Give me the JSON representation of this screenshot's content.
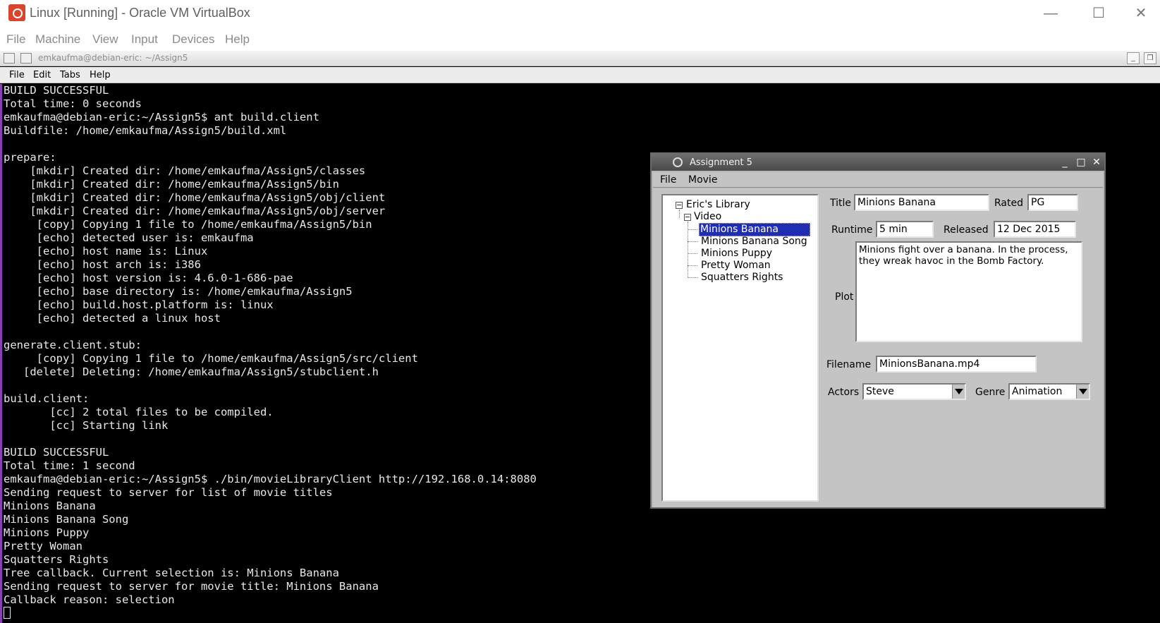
{
  "vbox": {
    "title": "Linux [Running] - Oracle VM VirtualBox",
    "controls": {
      "minimize": "—",
      "maximize": "☐",
      "close": "✕"
    },
    "menu": [
      "File",
      "Machine",
      "View",
      "Input",
      "Devices",
      "Help"
    ]
  },
  "terminal": {
    "title": "emkaufma@debian-eric: ~/Assign5",
    "menu": [
      "File",
      "Edit",
      "Tabs",
      "Help"
    ],
    "lines": [
      "BUILD SUCCESSFUL",
      "Total time: 0 seconds",
      "emkaufma@debian-eric:~/Assign5$ ant build.client",
      "Buildfile: /home/emkaufma/Assign5/build.xml",
      "",
      "prepare:",
      "    [mkdir] Created dir: /home/emkaufma/Assign5/classes",
      "    [mkdir] Created dir: /home/emkaufma/Assign5/bin",
      "    [mkdir] Created dir: /home/emkaufma/Assign5/obj/client",
      "    [mkdir] Created dir: /home/emkaufma/Assign5/obj/server",
      "     [copy] Copying 1 file to /home/emkaufma/Assign5/bin",
      "     [echo] detected user is: emkaufma",
      "     [echo] host name is: Linux",
      "     [echo] host arch is: i386",
      "     [echo] host version is: 4.6.0-1-686-pae",
      "     [echo] base directory is: /home/emkaufma/Assign5",
      "     [echo] build.host.platform is: linux",
      "     [echo] detected a linux host",
      "",
      "generate.client.stub:",
      "     [copy] Copying 1 file to /home/emkaufma/Assign5/src/client",
      "   [delete] Deleting: /home/emkaufma/Assign5/stubclient.h",
      "",
      "build.client:",
      "       [cc] 2 total files to be compiled.",
      "       [cc] Starting link",
      "",
      "BUILD SUCCESSFUL",
      "Total time: 1 second",
      "emkaufma@debian-eric:~/Assign5$ ./bin/movieLibraryClient http://192.168.0.14:8080",
      "Sending request to server for list of movie titles",
      "Minions Banana",
      "Minions Banana Song",
      "Minions Puppy",
      "Pretty Woman",
      "Squatters Rights",
      "Tree callback. Current selection is: Minions Banana",
      "Sending request to server for movie title: Minions Banana",
      "Callback reason: selection"
    ]
  },
  "dialog": {
    "title": "Assignment 5",
    "menu": [
      "File",
      "Movie"
    ],
    "tree": {
      "root": "Eric's Library",
      "category": "Video",
      "items": [
        "Minions Banana",
        "Minions Banana Song",
        "Minions Puppy",
        "Pretty Woman",
        "Squatters Rights"
      ],
      "selected_index": 0
    },
    "form": {
      "title_label": "Title",
      "title_value": "Minions Banana",
      "rated_label": "Rated",
      "rated_value": "PG",
      "runtime_label": "Runtime",
      "runtime_value": "5 min",
      "released_label": "Released",
      "released_value": "12 Dec 2015",
      "plot_label": "Plot",
      "plot_value": "Minions fight over a banana. In the process,\nthey wreak havoc in the Bomb Factory.",
      "filename_label": "Filename",
      "filename_value": "MinionsBanana.mp4",
      "actors_label": "Actors",
      "actors_value": "Steve",
      "genre_label": "Genre",
      "genre_value": "Animation"
    }
  }
}
